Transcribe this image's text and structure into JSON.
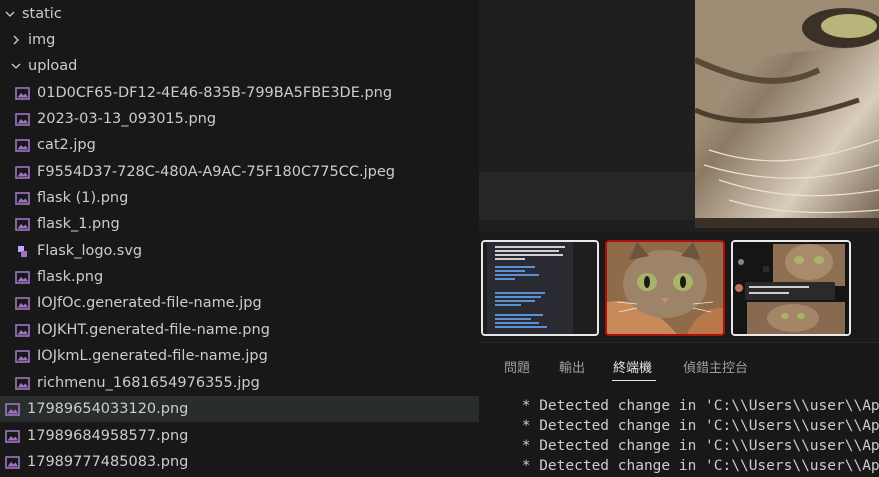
{
  "explorer": {
    "folders": {
      "static": "static",
      "img": "img",
      "upload": "upload"
    },
    "upload_files": [
      "01D0CF65-DF12-4E46-835B-799BA5FBE3DE.png",
      "2023-03-13_093015.png",
      "cat2.jpg",
      "F9554D37-728C-480A-A9AC-75F180C775CC.jpeg",
      "flask (1).png",
      "flask_1.png",
      "Flask_logo.svg",
      "flask.png",
      "IOJfOc.generated-file-name.jpg",
      "IOJKHT.generated-file-name.png",
      "IOJkmL.generated-file-name.jpg",
      "richmenu_1681654976355.jpg"
    ],
    "static_files": [
      "17989654033120.png",
      "17989684958577.png",
      "17989777485083.png"
    ]
  },
  "panel": {
    "tabs": [
      "問題",
      "輸出",
      "終端機",
      "偵錯主控台"
    ],
    "active_tab": "終端機",
    "terminal_lines": [
      " * Detected change in 'C:\\\\Users\\\\user\\\\Ap",
      " * Detected change in 'C:\\\\Users\\\\user\\\\Ap",
      " * Detected change in 'C:\\\\Users\\\\user\\\\Ap",
      " * Detected change in 'C:\\\\Users\\\\user\\\\Ap"
    ]
  },
  "colors": {
    "image_file_icon": "#a074c4",
    "svg_file_icon": "#c6a3ff",
    "selected_thumb_border": "#b10d0d"
  },
  "icons": {
    "folder_open": "chevron-down-icon",
    "folder_closed": "chevron-right-icon",
    "image_file": "image-file-icon",
    "svg_file": "svg-file-icon"
  }
}
